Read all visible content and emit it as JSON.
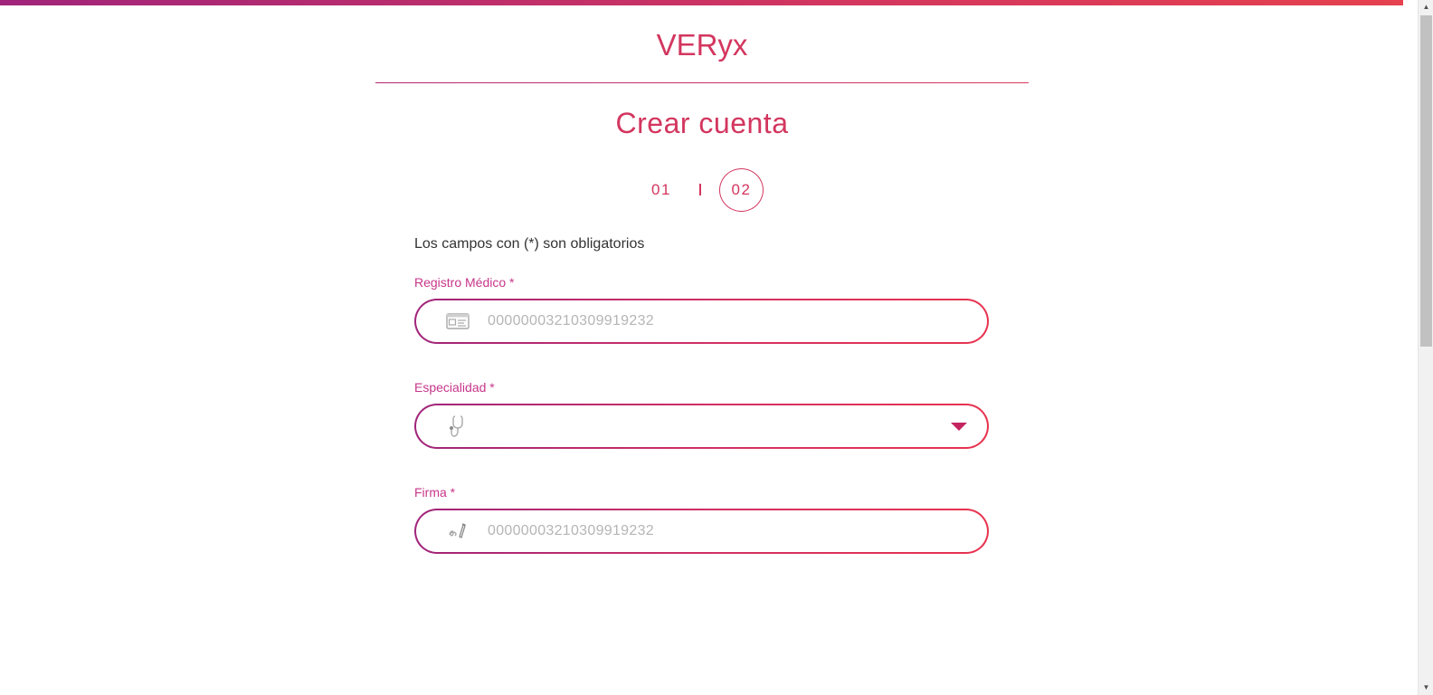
{
  "brand": {
    "name": "VERyx"
  },
  "page": {
    "title": "Crear cuenta",
    "required_note": "Los campos con (*) son obligatorios"
  },
  "steps": {
    "step1_label": "01",
    "step2_label": "02",
    "active_step": 2
  },
  "fields": {
    "medical_registry": {
      "label": "Registro Médico *",
      "placeholder": "00000003210309919232",
      "value": "",
      "icon": "id-card-icon"
    },
    "specialty": {
      "label": "Especialidad *",
      "selected": "",
      "icon": "stethoscope-icon"
    },
    "signature": {
      "label": "Firma *",
      "placeholder": "00000003210309919232",
      "value": "",
      "icon": "signature-pen-icon"
    }
  },
  "colors": {
    "accent": "#d3365f",
    "label": "#c7368a",
    "gradient_start": "#a0247a",
    "gradient_end": "#e8334f",
    "icon_gray": "#a8a8a8"
  }
}
